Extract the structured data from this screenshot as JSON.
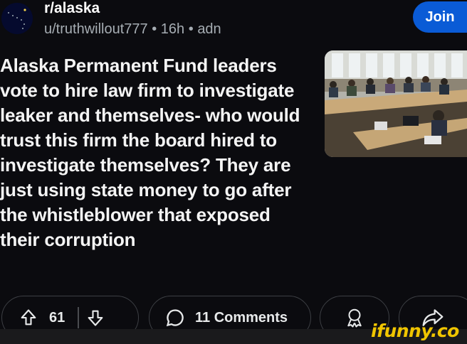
{
  "post": {
    "subreddit": "r/alaska",
    "author": "u/truthwillout777",
    "age": "16h",
    "flair": "adn",
    "separator": "•",
    "title": "Alaska Permanent Fund leaders vote to hire law firm to investigate leaker and themselves- who would trust this firm the board hired to investigate themselves? They are just using state money to go after the whistleblower that exposed their corruption"
  },
  "header": {
    "join_label": "Join"
  },
  "actions": {
    "vote_count": "61",
    "comments_label": "11 Comments"
  },
  "watermark": "ifunny.co",
  "colors": {
    "background": "#0b0b0f",
    "join_button": "#0a5bd6",
    "watermark": "#f0c500",
    "pill_border": "#3d3f44"
  },
  "icons": [
    "subreddit-avatar",
    "external-link-icon",
    "upvote-icon",
    "downvote-icon",
    "comment-icon",
    "award-icon",
    "share-icon"
  ]
}
